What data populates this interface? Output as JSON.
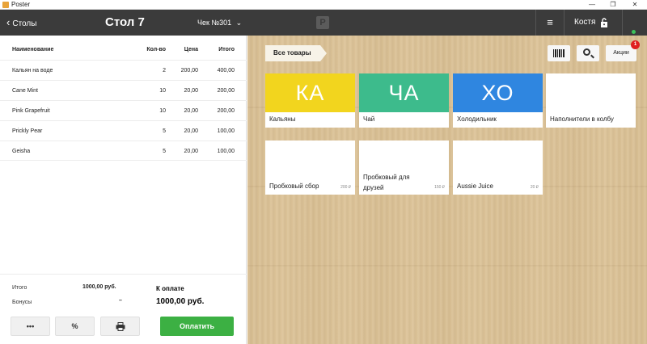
{
  "window": {
    "title": "Poster",
    "controls": [
      "—",
      "❐",
      "✕"
    ]
  },
  "header": {
    "back_label": "Столы",
    "table_title": "Стол 7",
    "check_label": "Чек №301",
    "logo_letter": "P",
    "menu_icon": "hamburger-icon",
    "user_name": "Костя",
    "lock_icon": "lock-icon",
    "status_color": "#3cc35a"
  },
  "order": {
    "columns": {
      "name": "Наименование",
      "qty": "Кол-во",
      "price": "Цена",
      "total": "Итого"
    },
    "rows": [
      {
        "name": "Кальян на воде",
        "qty": "2",
        "price": "200,00",
        "total": "400,00"
      },
      {
        "name": "Cane Mint",
        "qty": "10",
        "price": "20,00",
        "total": "200,00"
      },
      {
        "name": "Pink Grapefruit",
        "qty": "10",
        "price": "20,00",
        "total": "200,00"
      },
      {
        "name": "Prickly Pear",
        "qty": "5",
        "price": "20,00",
        "total": "100,00"
      },
      {
        "name": "Geisha",
        "qty": "5",
        "price": "20,00",
        "total": "100,00"
      }
    ]
  },
  "totals": {
    "total_label": "Итого",
    "total_value": "1000,00 руб.",
    "bonus_label": "Бонусы",
    "bonus_value": "–",
    "to_pay_label": "К оплате",
    "to_pay_value": "1000,00 руб."
  },
  "actions": {
    "more_label": "•••",
    "discount_label": "%",
    "print_icon": "printer-icon",
    "pay_label": "Оплатить",
    "pay_color": "#3cb043"
  },
  "catalog": {
    "breadcrumb": "Все товары",
    "barcode_icon": "barcode-icon",
    "search_icon": "search-icon",
    "promo_label": "Акции",
    "promo_badge": "1",
    "categories": [
      {
        "abbr": "КА",
        "name": "Кальяны",
        "color": "#f2d51e"
      },
      {
        "abbr": "ЧА",
        "name": "Чай",
        "color": "#3dbb8c"
      },
      {
        "abbr": "ХО",
        "name": "Холодильник",
        "color": "#2f86e0"
      },
      {
        "abbr": "",
        "name": "Наполнители в колбу",
        "color": "#ffffff"
      }
    ],
    "products": [
      {
        "name": "Пробковый сбор",
        "price": "200 ₽"
      },
      {
        "name": "Пробковый для друзей",
        "price": "150 ₽"
      },
      {
        "name": "Aussie Juice",
        "price": "20 ₽"
      }
    ]
  }
}
